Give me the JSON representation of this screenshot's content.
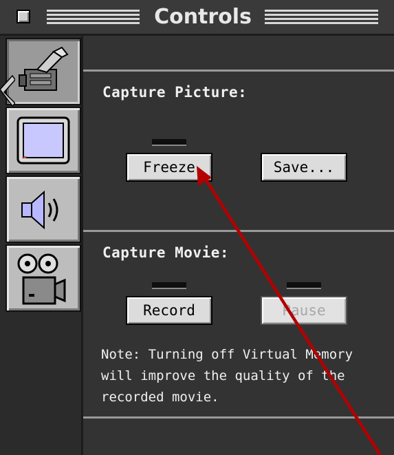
{
  "window": {
    "title": "Controls"
  },
  "sidebar": {
    "tabs": [
      {
        "name": "video-capture",
        "icon": "camcorder-icon",
        "active": true
      },
      {
        "name": "display",
        "icon": "monitor-icon",
        "active": false
      },
      {
        "name": "sound",
        "icon": "speaker-icon",
        "active": false
      },
      {
        "name": "movie",
        "icon": "film-projector-icon",
        "active": false
      }
    ]
  },
  "capture_picture": {
    "heading": "Capture Picture:",
    "freeze_label": "Freeze",
    "save_label": "Save..."
  },
  "capture_movie": {
    "heading": "Capture Movie:",
    "record_label": "Record",
    "pause_label": "Pause",
    "pause_enabled": false,
    "note_line1": "Note: Turning off Virtual Memory",
    "note_line2": "will improve the quality of the",
    "note_line3": "recorded movie."
  },
  "annotation": {
    "arrow_color": "#b30000"
  }
}
